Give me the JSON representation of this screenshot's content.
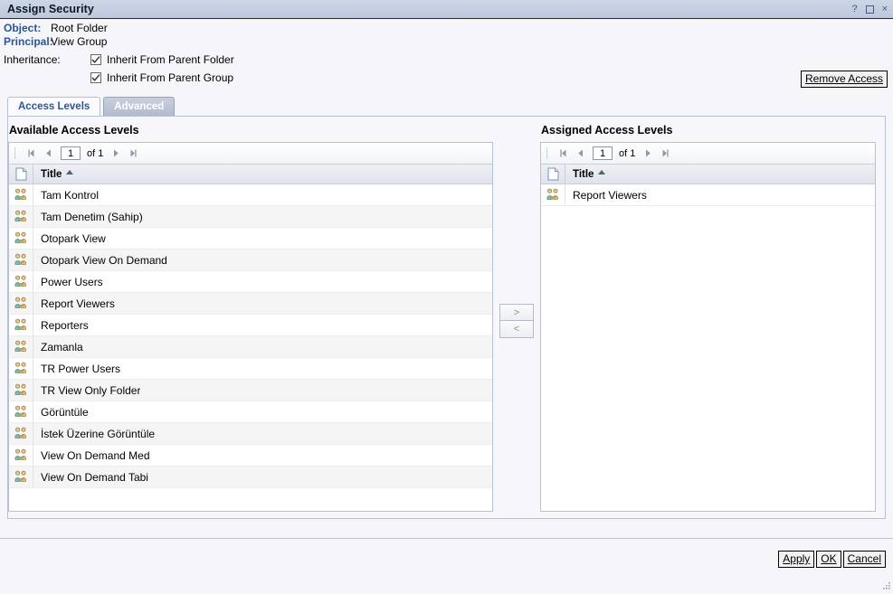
{
  "window": {
    "title": "Assign Security",
    "help_icon": "?",
    "maximize_icon": "maximize-box",
    "close_icon": "×"
  },
  "header": {
    "object_label": "Object:",
    "object_value": "Root Folder",
    "principal_label": "Principal:",
    "principal_value": "View Group",
    "inheritance_label": "Inheritance:",
    "inherit_folder_label": "Inherit From Parent Folder",
    "inherit_folder_checked": true,
    "inherit_group_label": "Inherit From Parent Group",
    "inherit_group_checked": true,
    "remove_access_label": "Remove Access"
  },
  "tabs": [
    {
      "label": "Access Levels",
      "active": true
    },
    {
      "label": "Advanced",
      "active": false
    }
  ],
  "available": {
    "title": "Available Access Levels",
    "pager": {
      "first_icon": "first-page-icon",
      "prev_icon": "prev-page-icon",
      "page_value": "1",
      "of_text": "of 1",
      "next_icon": "next-page-icon",
      "last_icon": "last-page-icon"
    },
    "column_icon": "document-icon",
    "column_title": "Title",
    "sort": "asc",
    "rows": [
      {
        "icon": "access-level-icon",
        "title": "Tam Kontrol"
      },
      {
        "icon": "access-level-icon",
        "title": "Tam Denetim (Sahip)"
      },
      {
        "icon": "access-level-icon",
        "title": "Otopark View"
      },
      {
        "icon": "access-level-icon",
        "title": "Otopark View On Demand"
      },
      {
        "icon": "access-level-icon",
        "title": "Power Users"
      },
      {
        "icon": "access-level-icon",
        "title": "Report Viewers"
      },
      {
        "icon": "access-level-icon",
        "title": "Reporters"
      },
      {
        "icon": "access-level-icon",
        "title": "Zamanla"
      },
      {
        "icon": "access-level-icon",
        "title": "TR Power Users"
      },
      {
        "icon": "access-level-icon",
        "title": "TR View Only Folder"
      },
      {
        "icon": "access-level-icon",
        "title": "Görüntüle"
      },
      {
        "icon": "access-level-icon",
        "title": "İstek Üzerine Görüntüle"
      },
      {
        "icon": "access-level-icon",
        "title": "View On Demand Med"
      },
      {
        "icon": "access-level-icon",
        "title": "View On Demand Tabi"
      }
    ]
  },
  "transfer": {
    "add_label": ">",
    "remove_label": "<"
  },
  "assigned": {
    "title": "Assigned Access Levels",
    "pager": {
      "first_icon": "first-page-icon",
      "prev_icon": "prev-page-icon",
      "page_value": "1",
      "of_text": "of 1",
      "next_icon": "next-page-icon",
      "last_icon": "last-page-icon"
    },
    "column_icon": "document-icon",
    "column_title": "Title",
    "sort": "asc",
    "rows": [
      {
        "icon": "access-level-icon",
        "title": "Report Viewers"
      }
    ]
  },
  "footer": {
    "apply_label": "Apply",
    "ok_label": "OK",
    "cancel_label": "Cancel"
  },
  "colors": {
    "titlebar": "#c2cde0",
    "label_blue": "#2a5699",
    "body_bg": "#f5f5fa",
    "row_alt": "#f5f5f5",
    "panel_border": "#b9c1d1"
  }
}
